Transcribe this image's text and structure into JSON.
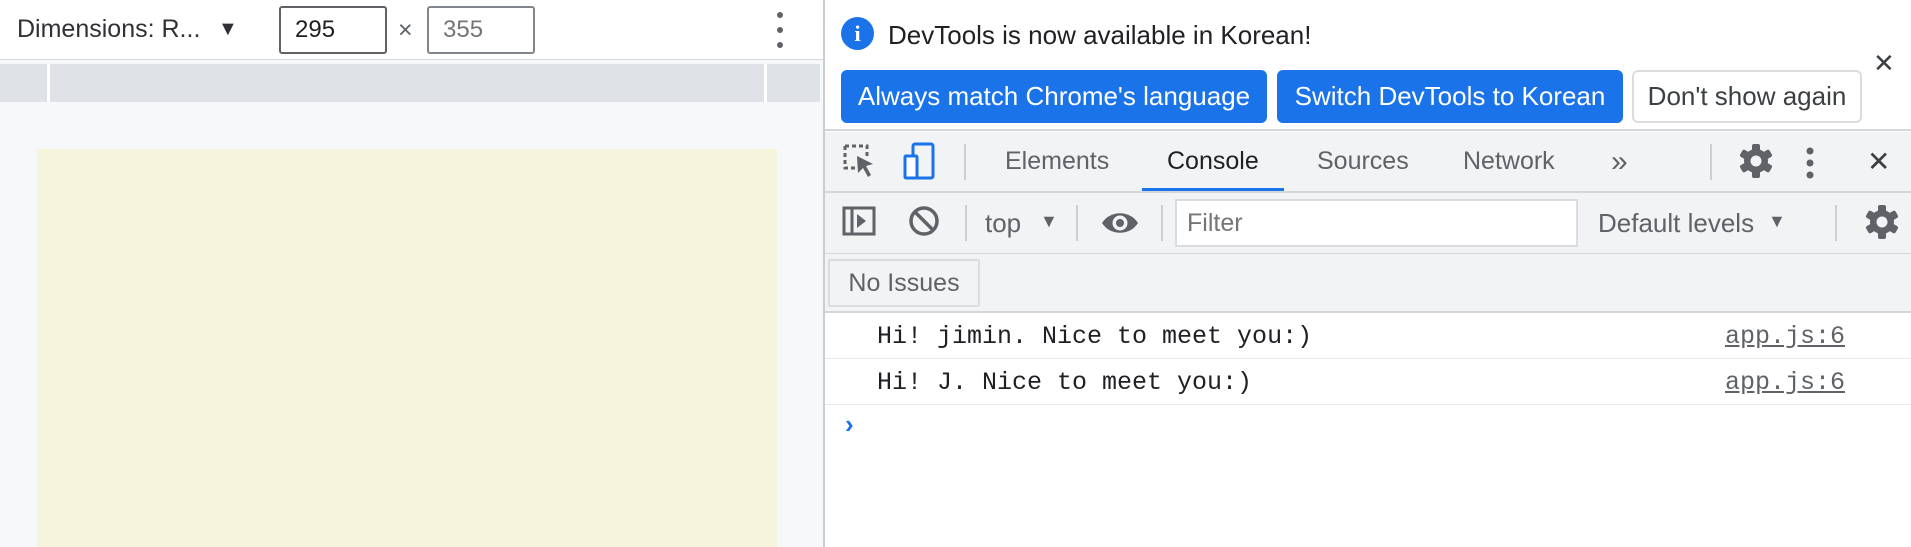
{
  "emulation": {
    "dimensions_label": "Dimensions: R...",
    "width_value": "295",
    "height_placeholder": "355",
    "times_symbol": "×"
  },
  "infobar": {
    "message": "DevTools is now available in Korean!",
    "info_glyph": "i",
    "close_glyph": "✕",
    "buttons": {
      "match": "Always match Chrome's language",
      "switch": "Switch DevTools to Korean",
      "dont_show": "Don't show again"
    }
  },
  "tabs": {
    "items": [
      "Elements",
      "Console",
      "Sources",
      "Network"
    ],
    "active": "Console",
    "overflow_glyph": "»",
    "close_glyph": "✕"
  },
  "console_toolbar": {
    "context": "top",
    "filter_placeholder": "Filter",
    "levels": "Default levels"
  },
  "issues": {
    "label": "No Issues"
  },
  "console": {
    "messages": [
      {
        "text": "Hi! jimin. Nice to meet you:)",
        "source": "app.js:6"
      },
      {
        "text": "Hi! J. Nice to meet you:)",
        "source": "app.js:6"
      }
    ],
    "prompt_glyph": "›"
  },
  "colors": {
    "accent": "#1a73e8",
    "viewport_bg": "#f5f5dc",
    "toolbar_bg": "#f1f3f4"
  }
}
